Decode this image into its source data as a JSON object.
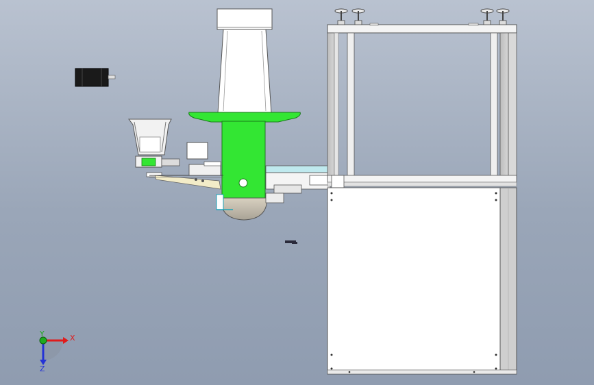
{
  "triad": {
    "x_label": "X",
    "y_label": "Y",
    "z_label": "Z",
    "x_color": "#e01b1b",
    "y_color": "#1faa1f",
    "z_color": "#2433d6"
  },
  "colors": {
    "accent_green": "#33e633",
    "frame": "#f4f4f4",
    "cabinet": "#ffffff",
    "motor": "#1a1a1a",
    "background": "#a3adbd"
  },
  "icons": {
    "axis_triad": "xyz-axis-triad-icon"
  }
}
